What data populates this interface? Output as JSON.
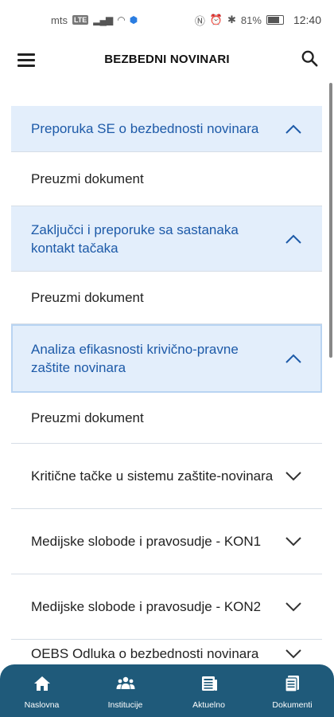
{
  "status_bar": {
    "carrier": "mts",
    "network": "LTE",
    "battery": "81%",
    "time": "12:40"
  },
  "app_bar": {
    "title": "BEZBEDNI NOVINARI"
  },
  "list": {
    "items": [
      {
        "kind": "header",
        "expanded": true,
        "label": "Preporuka SE o bezbednosti novinara"
      },
      {
        "kind": "body",
        "label": "Preuzmi dokument"
      },
      {
        "kind": "header",
        "expanded": true,
        "label": "Zaključci i preporuke sa sastanaka kontakt tačaka"
      },
      {
        "kind": "body",
        "label": "Preuzmi dokument"
      },
      {
        "kind": "header",
        "expanded": true,
        "label": "Analiza efikasnosti krivično-pravne zaštite novinara"
      },
      {
        "kind": "body",
        "label": "Preuzmi dokument"
      },
      {
        "kind": "collapsed",
        "expanded": false,
        "label": "Kritične tačke u sistemu zaštite-novinara"
      },
      {
        "kind": "collapsed",
        "expanded": false,
        "label": "Medijske slobode i pravosudje - KON1"
      },
      {
        "kind": "collapsed",
        "expanded": false,
        "label": "Medijske slobode i pravosudje - KON2"
      },
      {
        "kind": "collapsed",
        "expanded": false,
        "label": "OEBS Odluka o bezbednosti novinara"
      }
    ]
  },
  "bottom_nav": {
    "items": [
      {
        "label": "Naslovna",
        "icon": "home-icon"
      },
      {
        "label": "Institucije",
        "icon": "people-icon"
      },
      {
        "label": "Aktuelno",
        "icon": "news-icon"
      },
      {
        "label": "Dokumenti",
        "icon": "document-icon"
      }
    ]
  }
}
